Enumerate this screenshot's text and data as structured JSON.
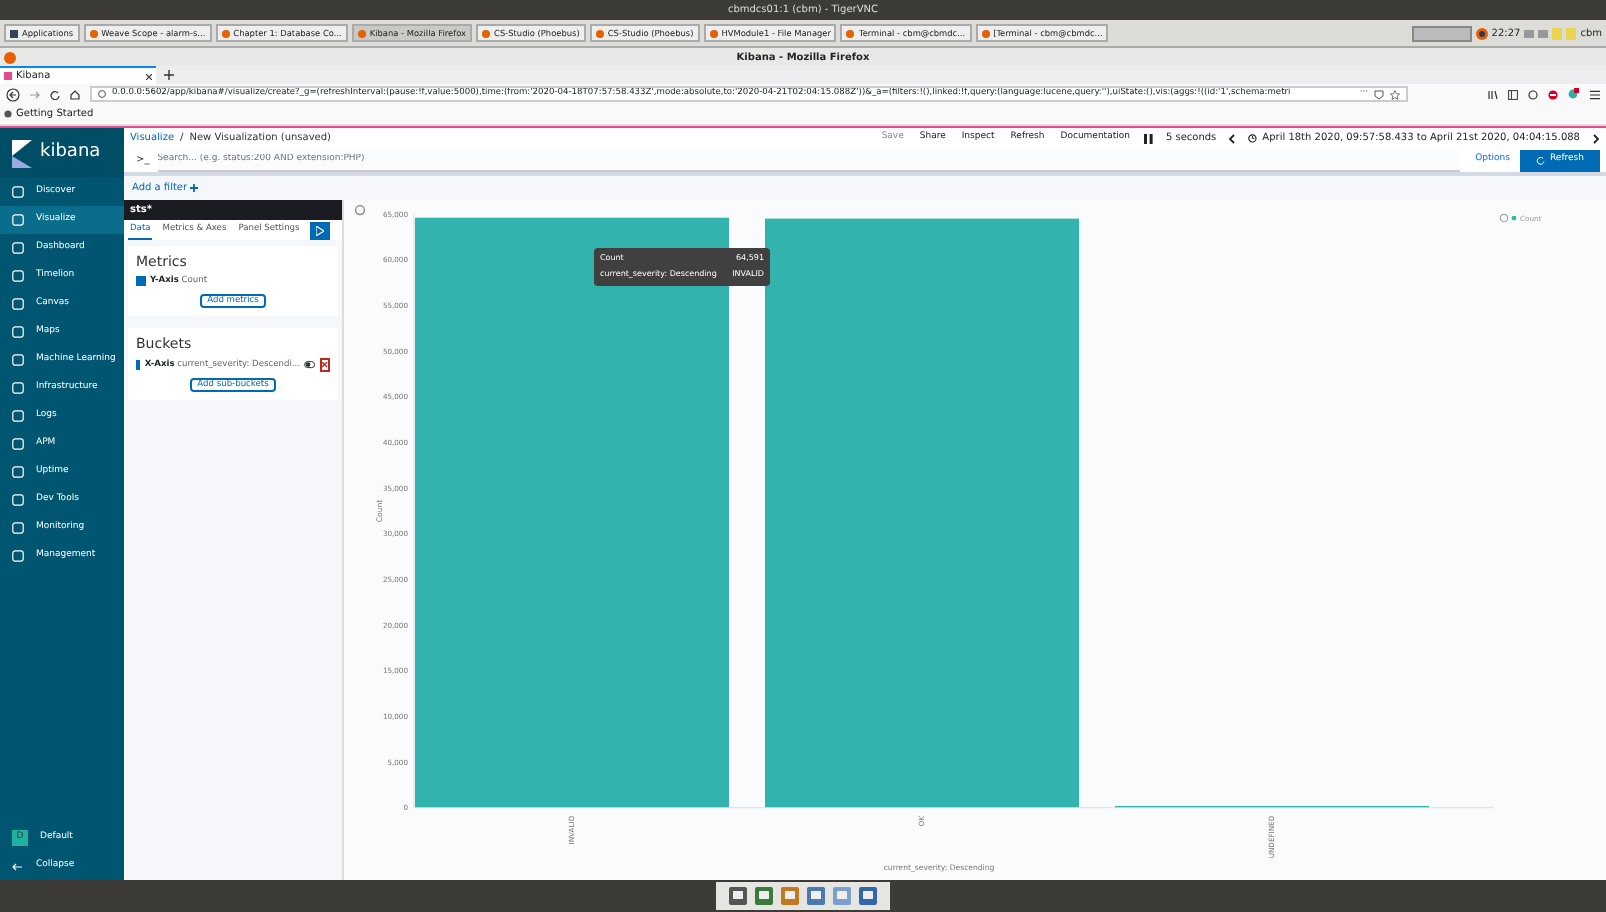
{
  "vnc_window": {
    "title": "cbmdcs01:1 (cbm) - TigerVNC"
  },
  "taskbar": {
    "items": [
      {
        "label": "Applications",
        "selected": false
      },
      {
        "label": "Weave Scope - alarm-s...",
        "selected": false
      },
      {
        "label": "Chapter 1: Database Co...",
        "selected": false
      },
      {
        "label": "Kibana - Mozilla Firefox",
        "selected": true
      },
      {
        "label": "CS-Studio (Phoebus)",
        "selected": false
      },
      {
        "label": "CS-Studio (Phoebus)",
        "selected": false
      },
      {
        "label": "HVModule1 - File Manager",
        "selected": false
      },
      {
        "label": "Terminal - cbm@cbmdc...",
        "selected": false
      },
      {
        "label": "[Terminal - cbm@cbmdc...",
        "selected": false
      }
    ],
    "clock": "22:27",
    "user": "cbm"
  },
  "browser": {
    "title": "Kibana - Mozilla Firefox",
    "tabs": [
      {
        "label": "Kibana",
        "selected": true
      }
    ],
    "url": "0.0.0.0:5602/app/kibana#/visualize/create?_g=(refreshInterval:(pause:!f,value:5000),time:(from:'2020-04-18T07:57:58.433Z',mode:absolute,to:'2020-04-21T02:04:15.088Z'))&_a=(filters:!(),linked:!f,query:(language:lucene,query:''),uiState:(),vis:(aggs:!((id:'1',schema:metri",
    "url_menu": "···",
    "bookmarks": [
      "Getting Started"
    ]
  },
  "kibana": {
    "logo": "kibana",
    "nav": [
      {
        "label": "Discover",
        "selected": false
      },
      {
        "label": "Visualize",
        "selected": true
      },
      {
        "label": "Dashboard",
        "selected": false
      },
      {
        "label": "Timelion",
        "selected": false
      },
      {
        "label": "Canvas",
        "selected": false
      },
      {
        "label": "Maps",
        "selected": false
      },
      {
        "label": "Machine Learning",
        "selected": false
      },
      {
        "label": "Infrastructure",
        "selected": false
      },
      {
        "label": "Logs",
        "selected": false
      },
      {
        "label": "APM",
        "selected": false
      },
      {
        "label": "Uptime",
        "selected": false
      },
      {
        "label": "Dev Tools",
        "selected": false
      },
      {
        "label": "Monitoring",
        "selected": false
      },
      {
        "label": "Management",
        "selected": false
      }
    ],
    "space": {
      "initial": "D",
      "label": "Default"
    },
    "collapse": "Collapse",
    "breadcrumbs": [
      "Visualize",
      "New Visualization (unsaved)"
    ],
    "separator": "/",
    "top_menu": [
      {
        "label": "Save",
        "disabled": true
      },
      {
        "label": "Share",
        "disabled": false
      },
      {
        "label": "Inspect",
        "disabled": false
      },
      {
        "label": "Refresh",
        "disabled": false
      },
      {
        "label": "Documentation",
        "disabled": false
      }
    ],
    "refresh_interval": "5 seconds",
    "time_range": "April 18th 2020, 09:57:58.433 to April 21st 2020, 04:04:15.088",
    "search": {
      "prompt": ">_",
      "placeholder": "Search... (e.g. status:200 AND extension:PHP)"
    },
    "options": "Options",
    "refresh_button": "Refresh",
    "add_filter": "Add a filter",
    "editor": {
      "index_pattern": "sts*",
      "tabs": [
        {
          "label": "Data",
          "selected": true
        },
        {
          "label": "Metrics & Axes",
          "selected": false
        },
        {
          "label": "Panel Settings",
          "selected": false
        }
      ],
      "sections": [
        {
          "title": "Metrics",
          "aggs": [
            {
              "axis": "Y-Axis",
              "label": "Count",
              "removable": false
            }
          ],
          "add_button": "Add metrics"
        },
        {
          "title": "Buckets",
          "aggs": [
            {
              "axis": "X-Axis",
              "label": "current_severity: Descendi...",
              "removable": true
            }
          ],
          "add_button": "Add sub-buckets"
        }
      ]
    },
    "chart_data": {
      "type": "bar",
      "xlabel": "current_severity: Descending",
      "ylabel": "Count",
      "categories": [
        "INVALID",
        "OK",
        "UNDEFINED"
      ],
      "series": [
        {
          "name": "Count",
          "color": "#32b3ad",
          "values": [
            64600,
            64500,
            200
          ]
        }
      ],
      "ylim": [
        0,
        65000
      ],
      "yticks": [
        {
          "value": 0,
          "label": "0"
        },
        {
          "value": 5000,
          "label": "5,000"
        },
        {
          "value": 10000,
          "label": "10,000"
        },
        {
          "value": 15000,
          "label": "15,000"
        },
        {
          "value": 20000,
          "label": "20,000"
        },
        {
          "value": 25000,
          "label": "25,000"
        },
        {
          "value": 30000,
          "label": "30,000"
        },
        {
          "value": 35000,
          "label": "35,000"
        },
        {
          "value": 40000,
          "label": "40,000"
        },
        {
          "value": 45000,
          "label": "45,000"
        },
        {
          "value": 50000,
          "label": "50,000"
        },
        {
          "value": 55000,
          "label": "55,000"
        },
        {
          "value": 60000,
          "label": "60,000"
        },
        {
          "value": 65000,
          "label": "65,000"
        }
      ]
    },
    "tooltip": {
      "rows": [
        {
          "label": "Count",
          "value": "64,591"
        },
        {
          "label": "current_severity: Descending",
          "value": "INVALID"
        }
      ]
    }
  }
}
